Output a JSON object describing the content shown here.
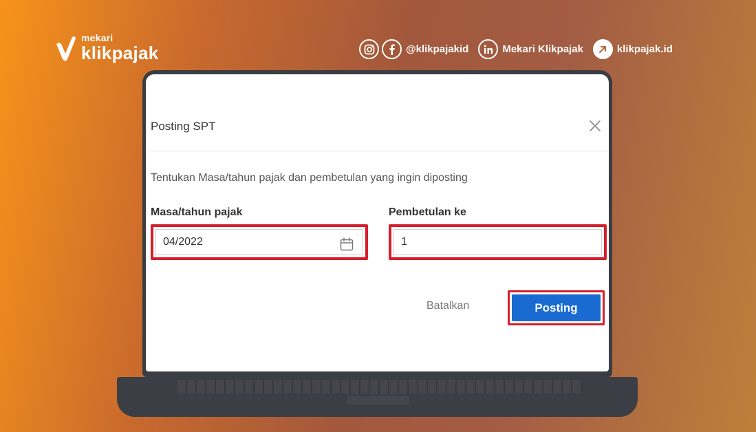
{
  "brand": {
    "small": "mekari",
    "name": "klikpajak",
    "icon": "check-logo-icon"
  },
  "social": {
    "instagram_icon": "instagram-icon",
    "facebook_icon": "facebook-icon",
    "handle": "@klikpajakid",
    "linkedin_icon": "linkedin-icon",
    "linkedin_name": "Mekari Klikpajak",
    "website_icon": "arrow-up-right-icon",
    "website": "klikpajak.id"
  },
  "dialog": {
    "title": "Posting SPT",
    "close_icon": "close-icon",
    "description": "Tentukan Masa/tahun pajak dan pembetulan yang ingin diposting",
    "masa_label": "Masa/tahun pajak",
    "masa_value": "04/2022",
    "calendar_icon": "calendar-icon",
    "pembetulan_label": "Pembetulan ke",
    "pembetulan_value": "1",
    "cancel_label": "Batalkan",
    "submit_label": "Posting"
  },
  "colors": {
    "highlight": "#d41f2c",
    "primary": "#1a6bd1",
    "bg_start": "#f7931a",
    "bg_mid": "#a2583c"
  }
}
